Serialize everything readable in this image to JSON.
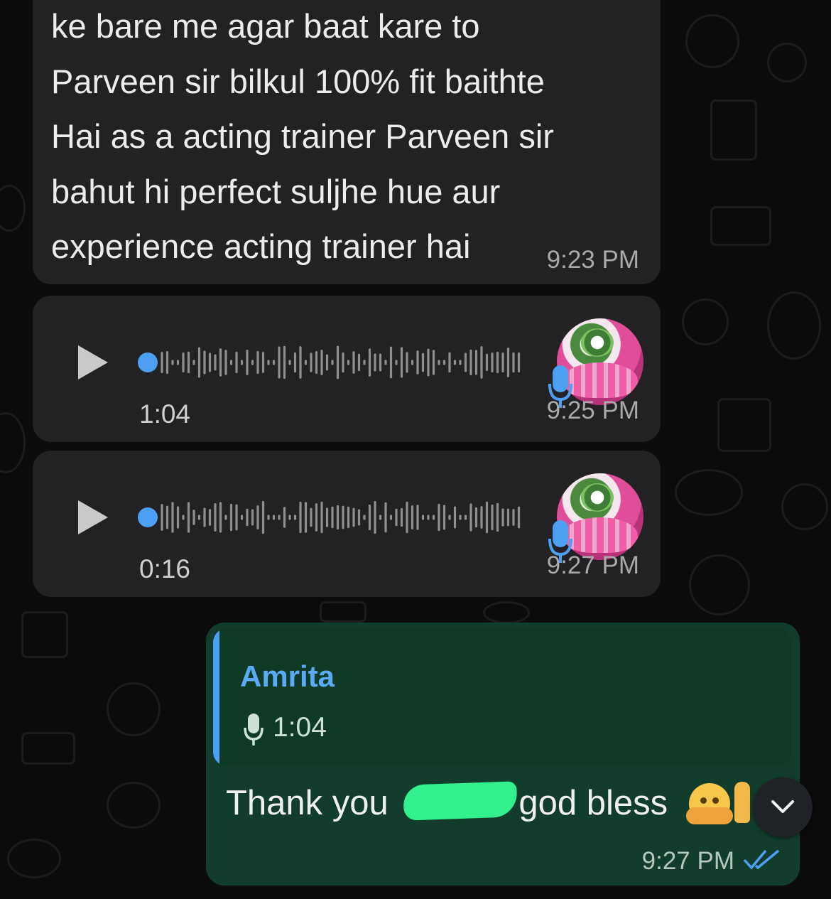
{
  "messages": {
    "incoming_text": {
      "lines": "ke bare me  agar baat kare to\nParveen sir bilkul 100% fit baithte\nHai as a acting trainer Parveen sir\nbahut hi perfect suljhe hue aur\nexperience acting trainer hai",
      "time": "9:23 PM"
    },
    "voice_notes": [
      {
        "duration": "1:04",
        "time": "9:25 PM",
        "progress": 0
      },
      {
        "duration": "0:16",
        "time": "9:27 PM",
        "progress": 0
      }
    ],
    "outgoing_reply": {
      "quoted_author": "Amrita",
      "quoted_duration": "1:04",
      "text_before": "Thank you ",
      "text_after": "god bless",
      "time": "9:27 PM",
      "status": "read"
    }
  },
  "colors": {
    "accent_blue": "#4d9ff4",
    "outgoing_bubble": "#123d2c",
    "incoming_bubble": "#222224",
    "redaction": "#33f08f"
  },
  "icons": {
    "play": "play-icon",
    "mic": "mic-icon",
    "read_ticks": "double-check-icon",
    "scroll_down": "chevron-down-icon"
  }
}
